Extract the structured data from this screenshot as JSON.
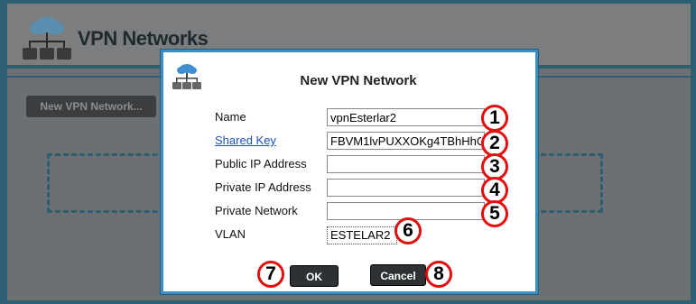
{
  "background": {
    "title": "VPN Networks",
    "new_button": "New VPN Network..."
  },
  "dialog": {
    "title": "New VPN Network",
    "fields": [
      {
        "label": "Name",
        "value": "vpnEsterlar2",
        "is_link": false
      },
      {
        "label": "Shared Key",
        "value": "FBVM1lvPUXXOKg4TBhHhC",
        "is_link": true
      },
      {
        "label": "Public IP Address",
        "value": "",
        "is_link": false
      },
      {
        "label": "Private IP Address",
        "value": "",
        "is_link": false
      },
      {
        "label": "Private Network",
        "value": "",
        "is_link": false
      }
    ],
    "vlan_label": "VLAN",
    "vlan_value": "ESTELAR2",
    "ok_label": "OK",
    "cancel_label": "Cancel"
  },
  "annotations": [
    "1",
    "2",
    "3",
    "4",
    "5",
    "6",
    "7",
    "8"
  ],
  "colors": {
    "modal_border": "#3a8fc4",
    "badge_border": "#e01010",
    "link": "#1a52c4",
    "page_bg": "#2d5f73"
  },
  "icons": [
    "cloud-network-icon"
  ]
}
